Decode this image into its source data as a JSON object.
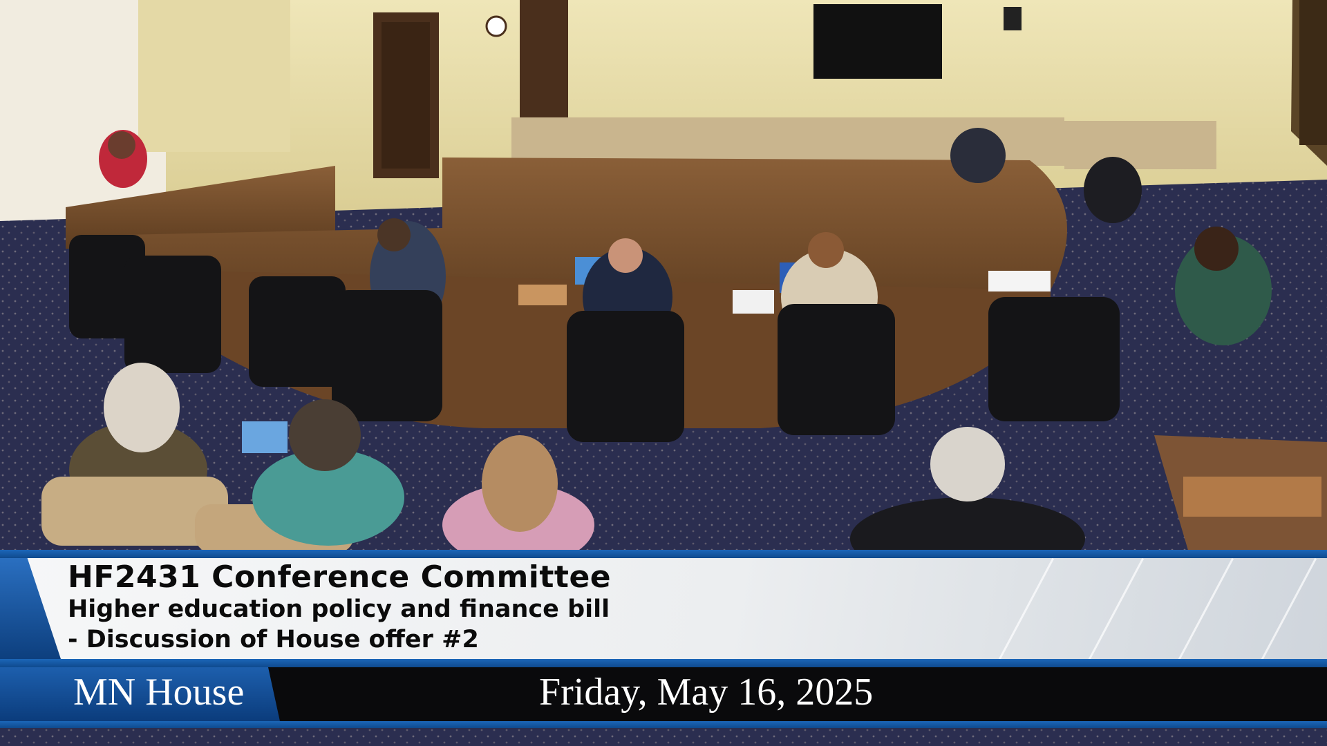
{
  "video": {
    "scene_description_hidden": null,
    "caption": {
      "title": "HF2431 Conference Committee",
      "subtitle_line1": "Higher education policy and finance bill",
      "subtitle_line2": "- Discussion of House offer #2",
      "brand": "MN House",
      "date": "Friday, May 16, 2025"
    }
  },
  "colors": {
    "accent_blue": "#1c66b8",
    "caption_bg": "#eceef0",
    "date_bar_bg": "#0a0a0c",
    "wall": "#e8dfae",
    "carpet": "#2c2f52",
    "wood": "#7a5230"
  }
}
